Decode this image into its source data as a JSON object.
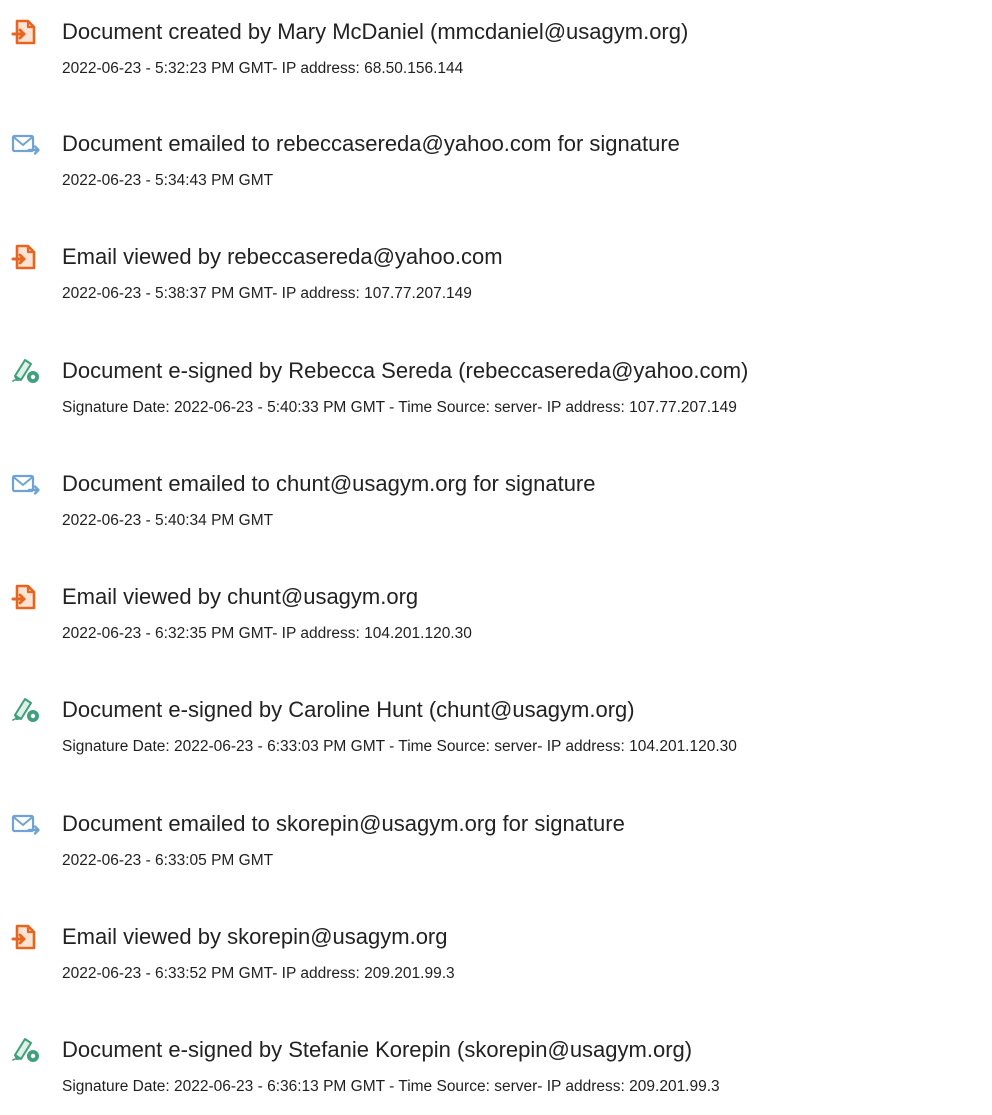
{
  "colors": {
    "document_icon": "#e8651f",
    "email_icon": "#6fa3d6",
    "sign_icon": "#3fa07a"
  },
  "entries": [
    {
      "icon": "document-icon",
      "title": "Document created by Mary McDaniel (mmcdaniel@usagym.org)",
      "detail": "2022-06-23 - 5:32:23 PM GMT- IP address: 68.50.156.144"
    },
    {
      "icon": "email-sent-icon",
      "title": "Document emailed to rebeccasereda@yahoo.com for signature",
      "detail": "2022-06-23 - 5:34:43 PM GMT"
    },
    {
      "icon": "document-icon",
      "title": "Email viewed by rebeccasereda@yahoo.com",
      "detail": "2022-06-23 - 5:38:37 PM GMT- IP address: 107.77.207.149"
    },
    {
      "icon": "esign-pen-icon",
      "title": "Document e-signed by Rebecca Sereda (rebeccasereda@yahoo.com)",
      "detail": "Signature Date: 2022-06-23 - 5:40:33 PM GMT - Time Source: server- IP address: 107.77.207.149"
    },
    {
      "icon": "email-sent-icon",
      "title": "Document emailed to chunt@usagym.org for signature",
      "detail": "2022-06-23 - 5:40:34 PM GMT"
    },
    {
      "icon": "document-icon",
      "title": "Email viewed by chunt@usagym.org",
      "detail": "2022-06-23 - 6:32:35 PM GMT- IP address: 104.201.120.30"
    },
    {
      "icon": "esign-pen-icon",
      "title": "Document e-signed by Caroline Hunt (chunt@usagym.org)",
      "detail": "Signature Date: 2022-06-23 - 6:33:03 PM GMT - Time Source: server- IP address: 104.201.120.30"
    },
    {
      "icon": "email-sent-icon",
      "title": "Document emailed to skorepin@usagym.org for signature",
      "detail": "2022-06-23 - 6:33:05 PM GMT"
    },
    {
      "icon": "document-icon",
      "title": "Email viewed by skorepin@usagym.org",
      "detail": "2022-06-23 - 6:33:52 PM GMT- IP address: 209.201.99.3"
    },
    {
      "icon": "esign-pen-icon",
      "title": "Document e-signed by Stefanie Korepin (skorepin@usagym.org)",
      "detail": "Signature Date: 2022-06-23 - 6:36:13 PM GMT - Time Source: server- IP address: 209.201.99.3"
    }
  ]
}
